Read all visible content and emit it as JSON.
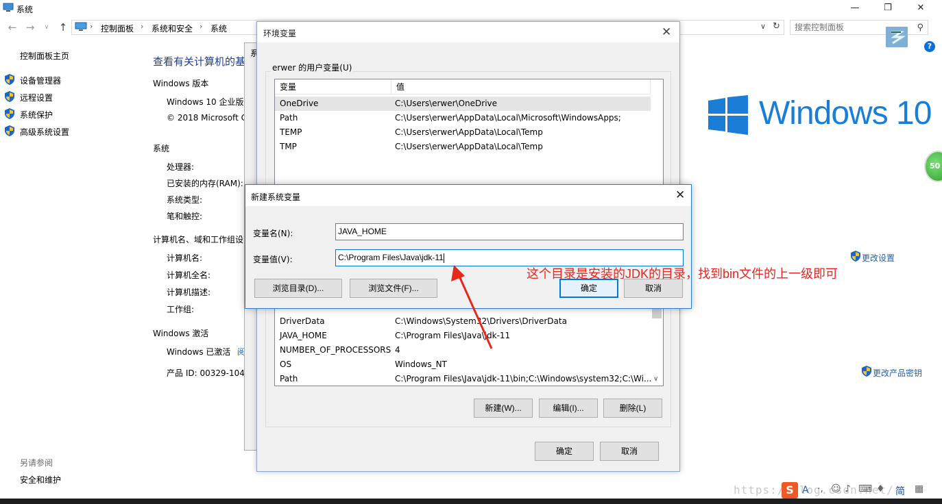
{
  "window": {
    "title": "系统",
    "minimize": "—",
    "maximize": "❐",
    "close": "✕"
  },
  "address": {
    "breadcrumbs": [
      "控制面板",
      "系统和安全",
      "系统"
    ],
    "search_placeholder": "搜索控制面板"
  },
  "sidebar": {
    "home": "控制面板主页",
    "items": [
      {
        "label": "设备管理器",
        "icon": "shield-icon"
      },
      {
        "label": "远程设置",
        "icon": "shield-icon"
      },
      {
        "label": "系统保护",
        "icon": "shield-icon"
      },
      {
        "label": "高级系统设置",
        "icon": "shield-icon"
      }
    ],
    "see_also": "另请参阅",
    "security": "安全和维护"
  },
  "main": {
    "heading": "查看有关计算机的基",
    "edition_section": "Windows 版本",
    "edition": "Windows 10 企业版",
    "copyright": "© 2018 Microsoft C",
    "system_section": "系统",
    "system_items": [
      "处理器:",
      "已安装的内存(RAM):",
      "系统类型:",
      "笔和触控:"
    ],
    "computer_section": "计算机名、域和工作组设",
    "computer_items": [
      "计算机名:",
      "计算机全名:",
      "计算机描述:",
      "工作组:"
    ],
    "change_settings": "更改设置",
    "activation_section": "Windows 激活",
    "activated": "Windows 已激活",
    "activated_link": "阅",
    "product_id": "产品 ID: 00329-1043",
    "change_key": "更改产品密钥",
    "logo_text": "Windows 10",
    "badge": "50"
  },
  "sysprop_dialog": {
    "title_fragment": "系"
  },
  "env_dialog": {
    "title": "环境变量",
    "close": "✕",
    "user_group": "erwer 的用户变量(U)",
    "columns": [
      "变量",
      "值"
    ],
    "user_vars": [
      {
        "name": "OneDrive",
        "value": "C:\\Users\\erwer\\OneDrive"
      },
      {
        "name": "Path",
        "value": "C:\\Users\\erwer\\AppData\\Local\\Microsoft\\WindowsApps;"
      },
      {
        "name": "TEMP",
        "value": "C:\\Users\\erwer\\AppData\\Local\\Temp"
      },
      {
        "name": "TMP",
        "value": "C:\\Users\\erwer\\AppData\\Local\\Temp"
      }
    ],
    "sys_vars": [
      {
        "name": "DriverData",
        "value": "C:\\Windows\\System32\\Drivers\\DriverData"
      },
      {
        "name": "JAVA_HOME",
        "value": "C:\\Program Files\\Java\\jdk-11"
      },
      {
        "name": "NUMBER_OF_PROCESSORS",
        "value": "4"
      },
      {
        "name": "OS",
        "value": "Windows_NT"
      },
      {
        "name": "Path",
        "value": "C:\\Program Files\\Java\\jdk-11\\bin;C:\\Windows\\system32;C:\\Wi..."
      }
    ],
    "new_button": "新建(W)...",
    "edit_button": "编辑(I)...",
    "delete_button": "删除(L)",
    "ok_button": "确定",
    "cancel_button": "取消"
  },
  "new_var_dialog": {
    "title": "新建系统变量",
    "close": "✕",
    "name_label": "变量名(N):",
    "name_value": "JAVA_HOME",
    "value_label": "变量值(V):",
    "value_value": "C:\\Program Files\\Java\\jdk-11",
    "browse_dir": "浏览目录(D)...",
    "browse_file": "浏览文件(F)...",
    "ok_button": "确定",
    "cancel_button": "取消"
  },
  "annotation": "这个目录是安装的JDK的目录，找到bin文件的上一级即可",
  "watermark": "https://blog.csdn.net/",
  "taskbar": {
    "ime_lang": "简"
  },
  "colors": {
    "accent": "#0078d7",
    "link": "#1e5fb6",
    "annotation": "#e8261c",
    "windows_blue": "#1a7ed6"
  }
}
